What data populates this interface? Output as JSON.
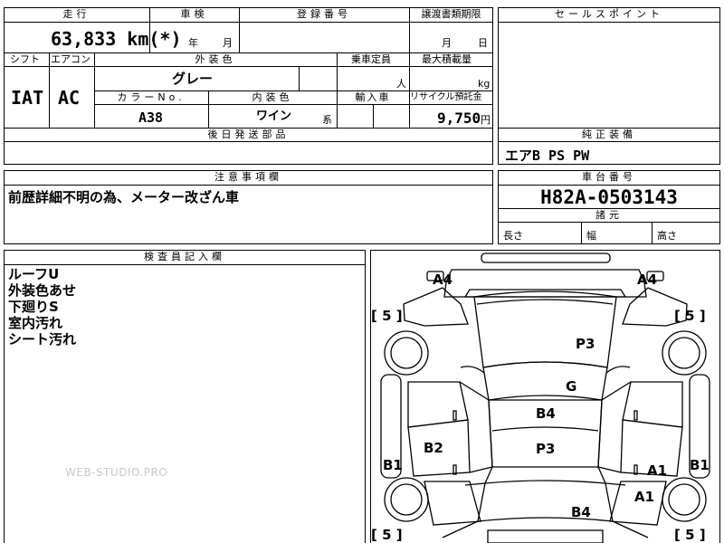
{
  "sheet": {
    "header": {
      "mileage_label": "走行",
      "inspection_label": "車検",
      "registration_label": "登録番号",
      "transfer_label": "譲渡書類期限",
      "sales_point_label": "セールスポイント"
    },
    "row1": {
      "mileage_value": "63,833",
      "mileage_unit": "km(*)",
      "inspection_year": "年",
      "inspection_month": "月",
      "transfer_month": "月",
      "transfer_day": "日"
    },
    "row2_labels": {
      "shift": "シフト",
      "aircon": "エアコン",
      "exterior_color": "外装色",
      "capacity": "乗車定員",
      "max_load": "最大積載量"
    },
    "row2_values": {
      "shift": "IAT",
      "aircon": "AC",
      "exterior_color": "グレー",
      "capacity_unit": "人",
      "load_unit": "kg"
    },
    "row3_labels": {
      "color_no": "カラーNo.",
      "interior_color": "内装色",
      "import": "輸入車",
      "recycle_fee": "リサイクル預託金"
    },
    "row3_values": {
      "color_no": "A38",
      "interior_color": "ワイン",
      "interior_suffix": "系",
      "recycle_fee": "9,750",
      "recycle_unit": "円"
    },
    "later_parts_label": "後日発送部品",
    "genuine_equipment_label": "純正装備",
    "genuine_equipment_value": "エアB PS PW",
    "notes_label": "注意事項欄",
    "notes_value": "前歴詳細不明の為、メーター改ざん車",
    "chassis_label": "車台番号",
    "chassis_value": "H82A-0503143",
    "dimensions_label": "諸元",
    "dim_length": "長さ",
    "dim_width": "幅",
    "dim_height": "高さ",
    "inspector_label": "検査員記入欄",
    "inspector_lines": [
      "ルーフU",
      "外装色あせ",
      "下廻りS",
      "室内汚れ",
      "シート汚れ"
    ],
    "watermark": "WEB-STUDIO.PRO"
  },
  "car_diagram": {
    "marks": {
      "a4_left": "A4",
      "a4_right": "A4",
      "p3_top": "P3",
      "g": "G",
      "b4_center": "B4",
      "p3_center": "P3",
      "b2": "B2",
      "b1_left": "B1",
      "b1_right": "B1",
      "a1_upper": "A1",
      "a1_lower": "A1",
      "b4_bottom": "B4"
    },
    "tire_labels": {
      "front_left": "[ 5 ]",
      "front_right": "[ 5 ]",
      "rear_left": "[ 5 ]",
      "rear_right": "[ 5 ]"
    }
  }
}
